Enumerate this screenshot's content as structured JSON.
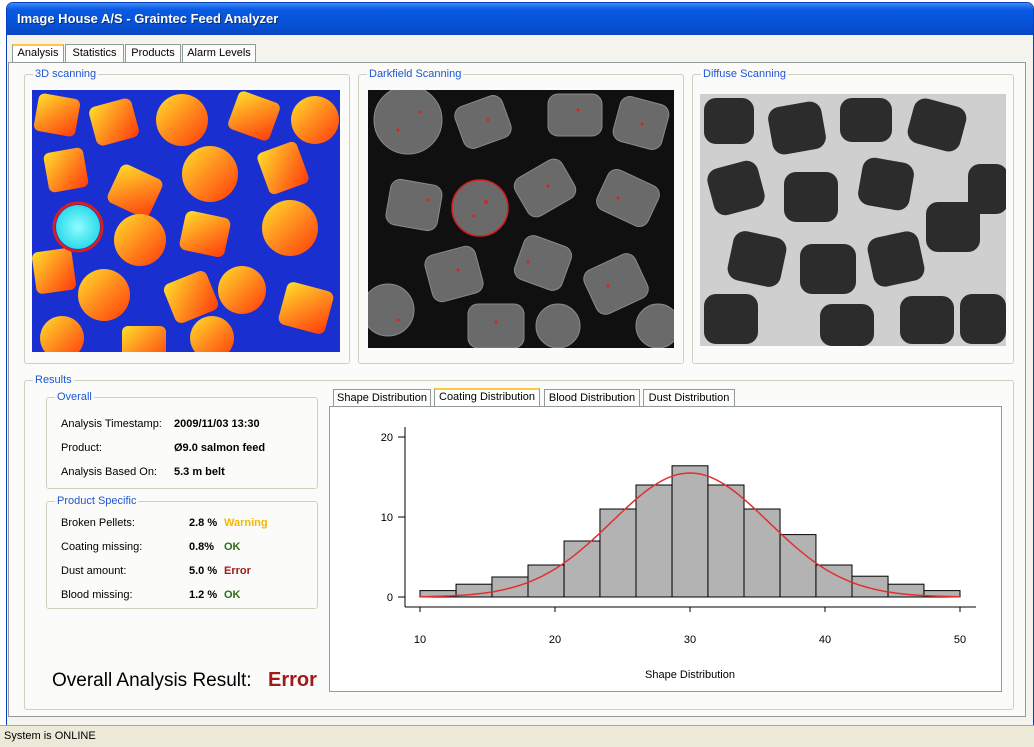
{
  "window": {
    "title": "Image House A/S - Graintec Feed Analyzer"
  },
  "tabs": [
    {
      "label": "Analysis",
      "active": true
    },
    {
      "label": "Statistics",
      "active": false
    },
    {
      "label": "Products",
      "active": false
    },
    {
      "label": "Alarm Levels",
      "active": false
    }
  ],
  "scans": {
    "scan3d": "3D scanning",
    "darkfield": "Darkfield Scanning",
    "diffuse": "Diffuse Scanning"
  },
  "results": {
    "title": "Results",
    "overall": {
      "title": "Overall",
      "rows": [
        {
          "label": "Analysis Timestamp:",
          "value": "2009/11/03 13:30"
        },
        {
          "label": "Product:",
          "value": "Ø9.0 salmon feed"
        },
        {
          "label": "Analysis Based On:",
          "value": "5.3 m belt"
        }
      ]
    },
    "product_specific": {
      "title": "Product Specific",
      "rows": [
        {
          "label": "Broken Pellets:",
          "value": "2.8 %",
          "status": "Warning",
          "color": "#f5b800"
        },
        {
          "label": "Coating missing:",
          "value": "0.8%",
          "status": "OK",
          "color": "#2f6b1a"
        },
        {
          "label": "Dust amount:",
          "value": "5.0 %",
          "status": "Error",
          "color": "#a11919"
        },
        {
          "label": "Blood missing:",
          "value": "1.2 %",
          "status": "OK",
          "color": "#2f6b1a"
        }
      ]
    },
    "overall_result_label": "Overall Analysis Result:",
    "overall_result_value": "Error"
  },
  "chart_tabs": [
    {
      "label": "Shape Distribution",
      "active": false
    },
    {
      "label": "Coating Distribution",
      "active": true
    },
    {
      "label": "Blood Distribution",
      "active": false
    },
    {
      "label": "Dust Distribution",
      "active": false
    }
  ],
  "chart_data": {
    "type": "bar",
    "xlabel": "Shape Distribution",
    "ylabel": "",
    "xlim": [
      10,
      50
    ],
    "ylim": [
      0,
      20
    ],
    "x_ticks": [
      10,
      20,
      30,
      40,
      50
    ],
    "y_ticks": [
      0,
      10,
      20
    ],
    "bin_edges": [
      10,
      12.67,
      15.33,
      18,
      20.67,
      23.33,
      26,
      28.67,
      31.33,
      34,
      36.67,
      39.33,
      42,
      44.67,
      47.33,
      50
    ],
    "counts": [
      0.8,
      1.6,
      2.5,
      4,
      7,
      11,
      14,
      16.4,
      14,
      11,
      7.8,
      4,
      2.6,
      1.6,
      0.8
    ],
    "fit_curve": {
      "type": "normal",
      "mean": 30,
      "sd": 5.8,
      "peak": 15.5,
      "color": "#e03030"
    },
    "bar_color": "#b3b3b3",
    "grid": false
  },
  "statusbar": {
    "text": "System is ONLINE"
  }
}
